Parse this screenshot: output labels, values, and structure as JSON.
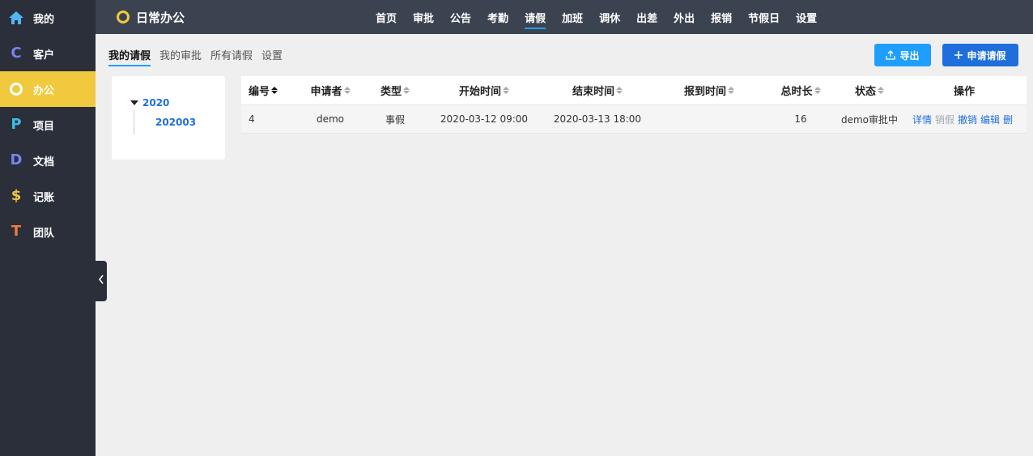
{
  "sidebar": {
    "items": [
      {
        "label": "我的",
        "icon": "home-icon",
        "glyph": "⌂",
        "color": "#52b6f5"
      },
      {
        "label": "客户",
        "icon": "customer-c-icon",
        "glyph": "C",
        "color": "#7b83f0"
      },
      {
        "label": "办公",
        "icon": "office-circle-icon",
        "glyph": "○",
        "color": "#ffffff"
      },
      {
        "label": "项目",
        "icon": "project-p-icon",
        "glyph": "P",
        "color": "#3dbbe8"
      },
      {
        "label": "文档",
        "icon": "document-d-icon",
        "glyph": "D",
        "color": "#7b83f0"
      },
      {
        "label": "记账",
        "icon": "dollar-icon",
        "glyph": "$",
        "color": "#f0c93e"
      },
      {
        "label": "团队",
        "icon": "team-t-icon",
        "glyph": "T",
        "color": "#f07a3e"
      }
    ]
  },
  "header": {
    "title": "日常办公",
    "nav": [
      "首页",
      "审批",
      "公告",
      "考勤",
      "请假",
      "加班",
      "调休",
      "出差",
      "外出",
      "报销",
      "节假日",
      "设置"
    ]
  },
  "subtabs": [
    "我的请假",
    "我的审批",
    "所有请假",
    "设置"
  ],
  "buttons": {
    "export": "导出",
    "apply": "申请请假"
  },
  "tree": {
    "year": "2020",
    "month": "202003"
  },
  "table": {
    "columns": [
      "编号",
      "申请者",
      "类型",
      "开始时间",
      "结束时间",
      "报到时间",
      "总时长",
      "状态",
      "操作"
    ],
    "rows": [
      {
        "id": "4",
        "applicant": "demo",
        "type": "事假",
        "start": "2020-03-12 09:00",
        "end": "2020-03-13 18:00",
        "report": "",
        "duration": "16",
        "status": "demo审批中",
        "ops": [
          "详情",
          "销假",
          "撤销",
          "编辑",
          "删"
        ]
      }
    ]
  },
  "colors": {
    "accent": "#1e9fff",
    "active_sidebar": "#f0c93e",
    "sidebar_bg": "#2a2f39",
    "header_bg": "#3c4350"
  }
}
